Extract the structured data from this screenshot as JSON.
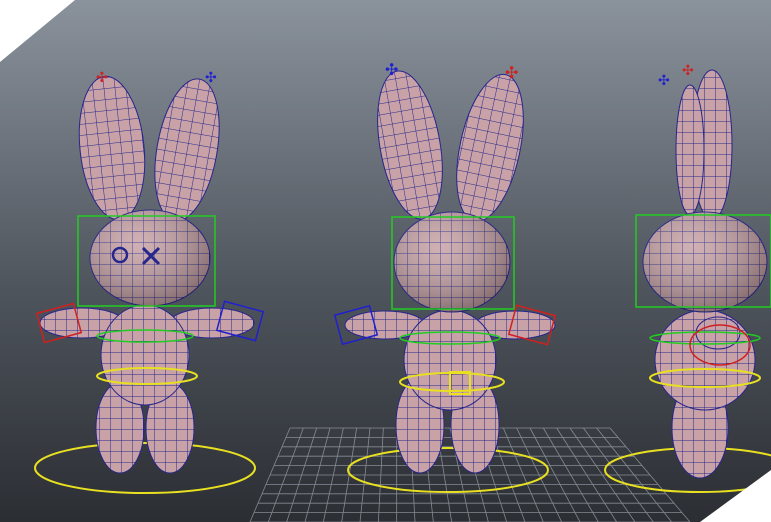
{
  "viewport": {
    "background_top": "#8a929c",
    "background_bottom": "#2b2e33",
    "mesh_fill": "#c8a2a6",
    "wire_color": "#26268c",
    "control_colors": {
      "head": "#22cc22",
      "waist": "#e8e020",
      "left_side": "#d02020",
      "right_side": "#2020d0",
      "ground": "#e8e020"
    },
    "grid_color": "#9aa0a8"
  },
  "characters": [
    {
      "view": "front"
    },
    {
      "view": "back"
    },
    {
      "view": "side"
    }
  ]
}
